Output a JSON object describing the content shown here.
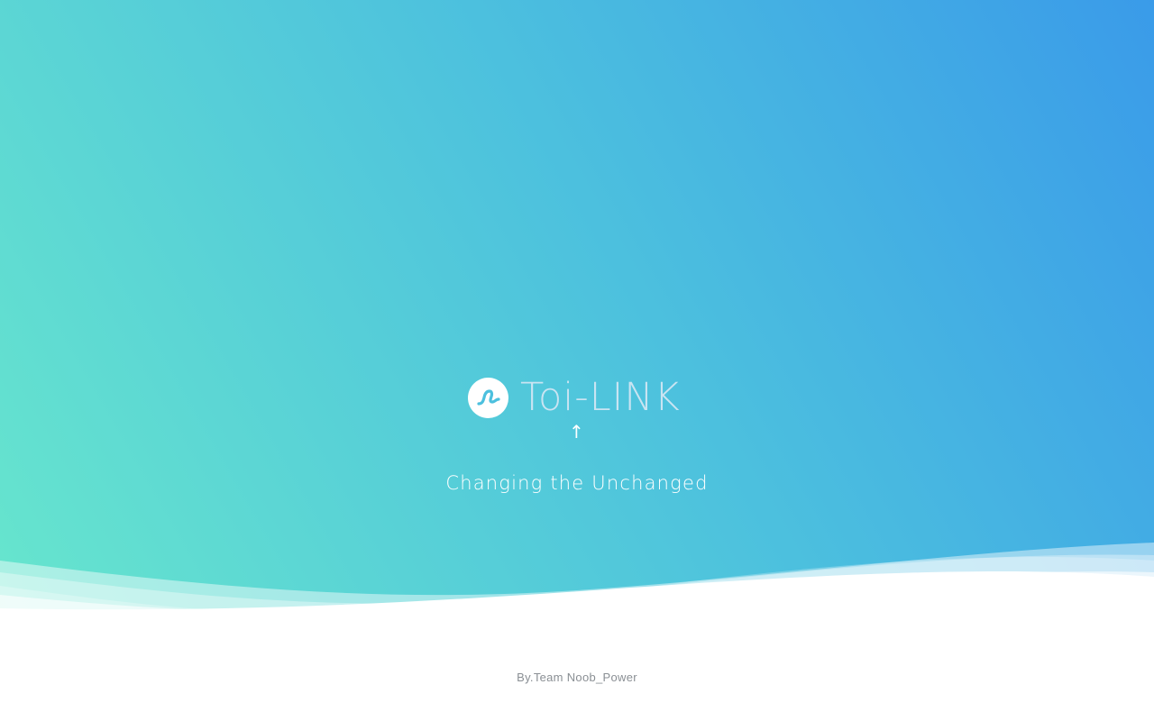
{
  "brand": {
    "name": "Toi-LINK",
    "logo_icon": "wave-logo-icon"
  },
  "arrow": {
    "glyph": "↑",
    "icon": "arrow-up-icon"
  },
  "tagline": "Changing the Unchanged",
  "credit": "By.Team Noob_Power",
  "colors": {
    "gradient_left": "#67e6cd",
    "gradient_mid": "#4cc0de",
    "gradient_right": "#3a9be9",
    "brand_text": "#c9e4f2",
    "logo_mark": "#4cc0de",
    "credit_text": "#8a8f94"
  }
}
